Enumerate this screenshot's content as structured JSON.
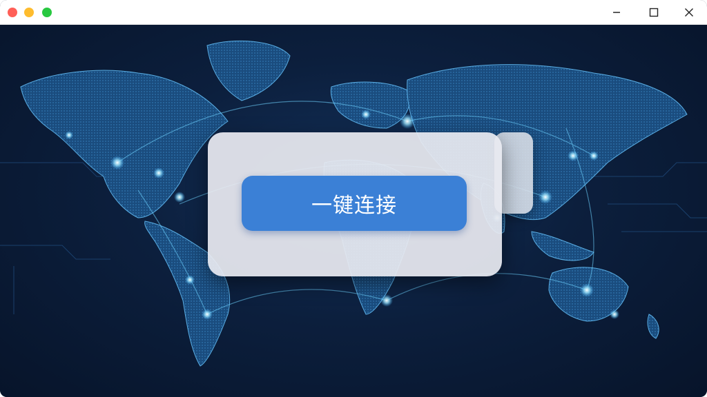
{
  "window": {
    "controls": {
      "close_color": "#ff5f57",
      "minimize_color": "#febc2e",
      "zoom_color": "#28c840"
    },
    "right_controls": [
      "minimize-icon",
      "maximize-icon",
      "close-icon"
    ]
  },
  "background": {
    "image": "world-map-network",
    "colors": {
      "base": "#0b1a33",
      "land": "#1d5a8f",
      "glow": "#7fd8ff"
    }
  },
  "dialog": {
    "connect_button_label": "一键连接",
    "button_color": "#3b80d6"
  }
}
